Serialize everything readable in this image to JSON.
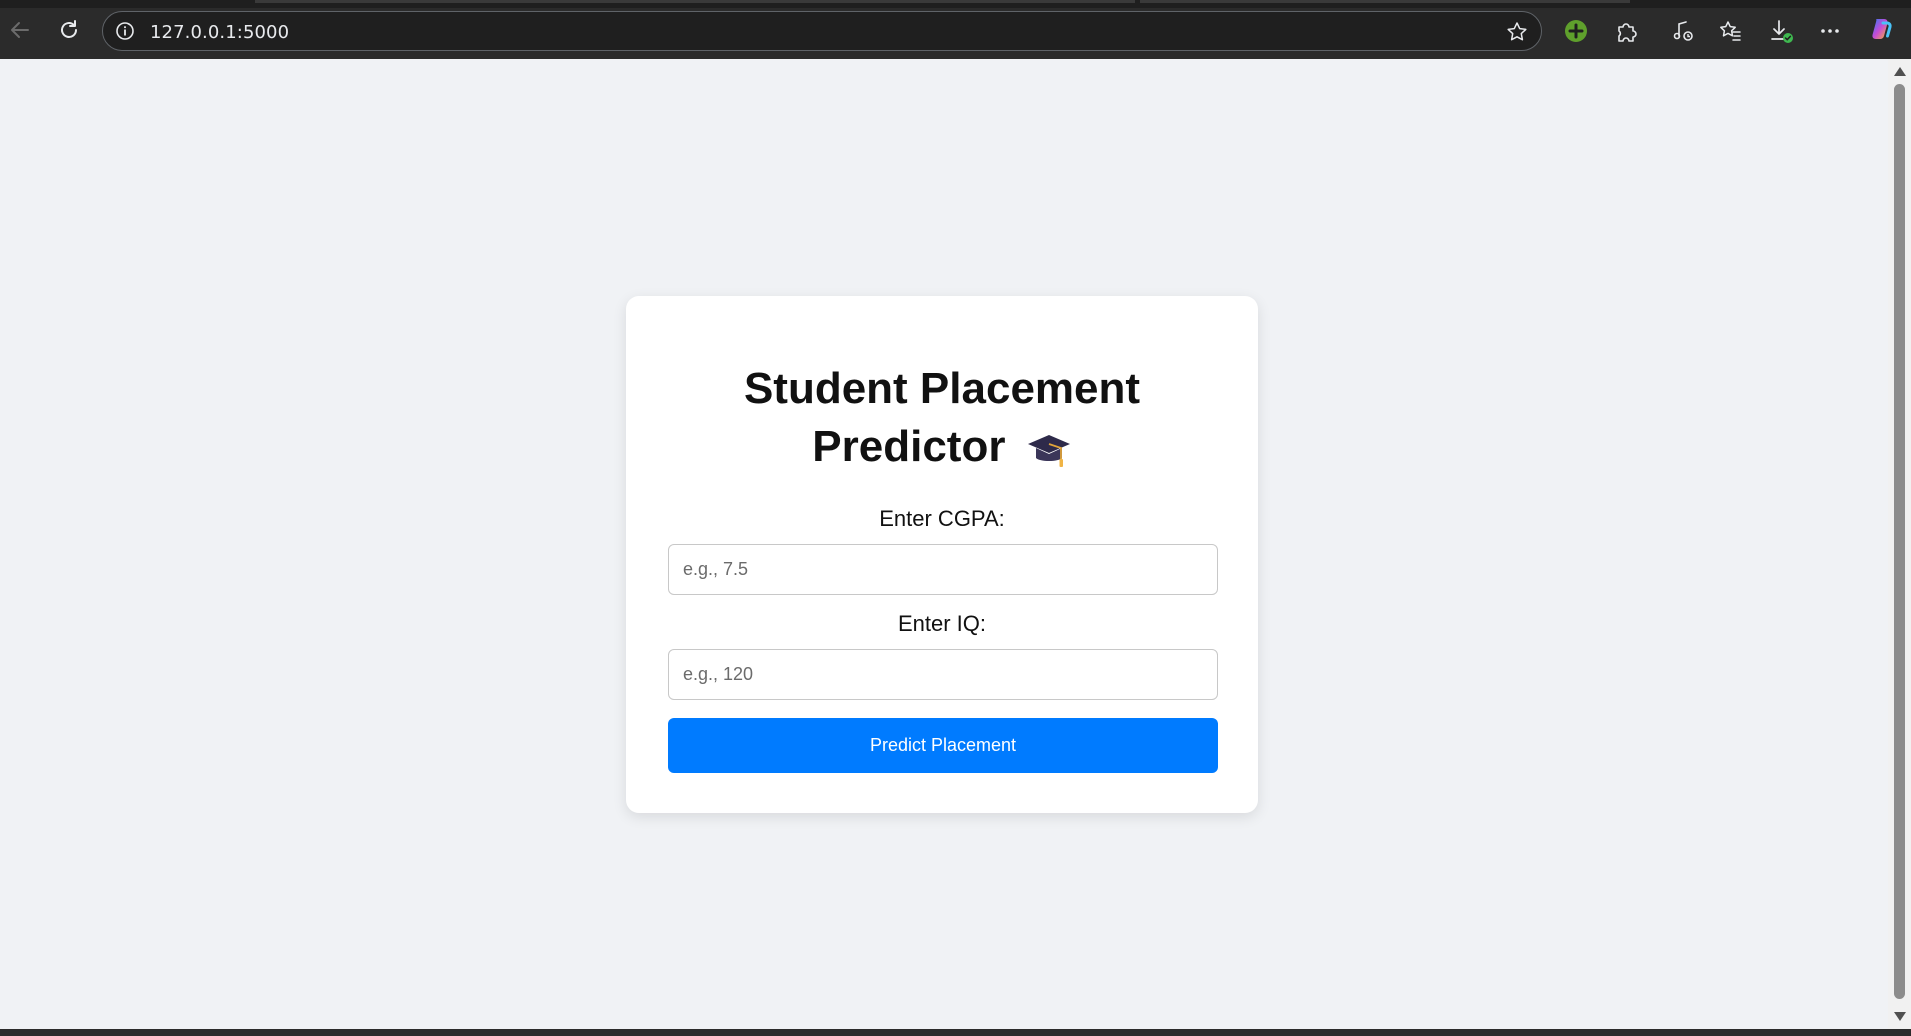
{
  "browser": {
    "url": "127.0.0.1:5000",
    "icons": [
      "back-arrow-icon",
      "reload-icon",
      "site-info-icon",
      "favorite-star-icon",
      "add-extension-icon",
      "extensions-puzzle-icon",
      "read-aloud-icon",
      "favorites-icon",
      "downloads-icon",
      "more-menu-icon",
      "copilot-icon"
    ]
  },
  "page": {
    "title_line1": "Student Placement",
    "title_line2": "Predictor",
    "title_icon": "graduation-cap-icon",
    "cgpa": {
      "label": "Enter CGPA:",
      "placeholder": "e.g., 7.5",
      "value": ""
    },
    "iq": {
      "label": "Enter IQ:",
      "placeholder": "e.g., 120",
      "value": ""
    },
    "submit_label": "Predict Placement"
  },
  "colors": {
    "accent": "#007bff",
    "page_background": "#f0f2f5",
    "card_background": "#ffffff",
    "browser_chrome": "#2b2b2b"
  }
}
